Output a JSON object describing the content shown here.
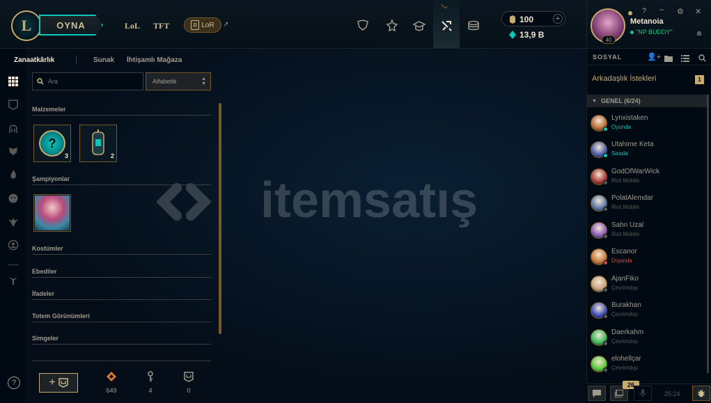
{
  "header": {
    "logo_letter": "L",
    "play_label": "OYNA",
    "nav": {
      "lol": "LoL",
      "tft": "TFT",
      "lor": "LoR",
      "lor_badge": "R"
    },
    "currency": {
      "be_value": "100",
      "rp_value": "13,9 B"
    },
    "profile": {
      "name": "Metanoia",
      "status": "\"NP BUDDY\"",
      "level": "40"
    },
    "window_controls": {
      "help": "?",
      "minimize": "–",
      "settings": "⚙",
      "close": "✕"
    }
  },
  "main": {
    "tabs": [
      {
        "label": "Zanaatkârlık",
        "active": true
      },
      {
        "label": "Sunak",
        "active": false
      },
      {
        "label": "İhtişamlı Mağaza",
        "active": false
      }
    ],
    "search": {
      "placeholder": "Ara"
    },
    "sort": {
      "selected": "Alfabetik"
    },
    "categories": {
      "materials": "Malzemeler",
      "champions": "Şampiyonlar",
      "skins": "Kostümler",
      "eternals": "Ebediler",
      "emotes": "İfadeler",
      "ward_skins": "Totem Görünümleri",
      "icons": "Simgeler"
    },
    "material_counts": {
      "orb": "3",
      "capsule": "2"
    },
    "footer": {
      "add_label": "+",
      "essence": "649",
      "keys": "4",
      "chests": "0"
    },
    "help": "?"
  },
  "social": {
    "title": "SOSYAL",
    "requests_label": "Arkadaşlık İstekleri",
    "requests_count": "1",
    "group_label": "GENEL (6/24)",
    "friends": [
      {
        "name": "Lynxistaken",
        "status": "Oyunda",
        "status_color": "#0ac8b9",
        "avatar": "#b86a3a"
      },
      {
        "name": "Utahime Keta",
        "status": "Sırada",
        "status_color": "#0ac8b9",
        "avatar": "#4a5aa8"
      },
      {
        "name": "GodOfWarWick",
        "status": "Riot Mobile",
        "status_color": "#5b5a56",
        "avatar": "#a83a3a"
      },
      {
        "name": "PolatAlemdar",
        "status": "Riot Mobile",
        "status_color": "#5b5a56",
        "avatar": "#5a78a8"
      },
      {
        "name": "Sahn Uzal",
        "status": "Riot Mobile",
        "status_color": "#5b5a56",
        "avatar": "#8a5ab8"
      },
      {
        "name": "Escanor",
        "status": "Dışanda",
        "status_color": "#c84a4a",
        "avatar": "#c8783a"
      },
      {
        "name": "AjanFiko",
        "status": "Çevrimdışı",
        "status_color": "#5b5a56",
        "avatar": "#c8a07a"
      },
      {
        "name": "Burakhan",
        "status": "Çevrimdışı",
        "status_color": "#5b5a56",
        "avatar": "#3a4ab8"
      },
      {
        "name": "Daerkahm",
        "status": "Çevrimdışı",
        "status_color": "#5b5a56",
        "avatar": "#3ab85a"
      },
      {
        "name": "elohellçar",
        "status": "Çevrimdışı",
        "status_color": "#5b5a56",
        "avatar": "#5ac83a"
      }
    ],
    "bottom": {
      "badge": "26",
      "clock": "25:24"
    }
  },
  "colors": {
    "gold": "#c8aa6e",
    "teal": "#0ac8b9",
    "bg": "#010a13",
    "online": "#0acf83"
  }
}
